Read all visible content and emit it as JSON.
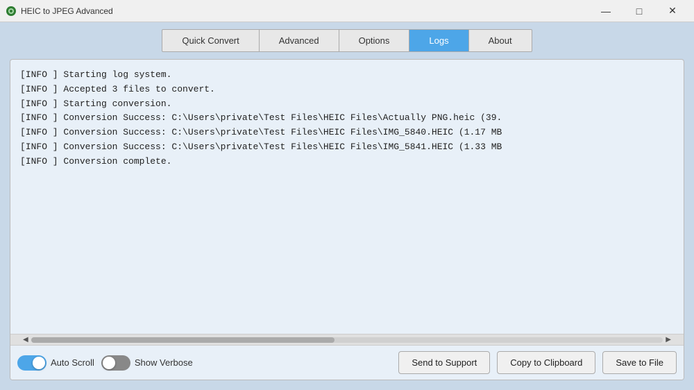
{
  "titlebar": {
    "title": "HEIC to JPEG Advanced",
    "minimize": "—",
    "maximize": "□",
    "close": "✕"
  },
  "tabs": [
    {
      "id": "quick-convert",
      "label": "Quick Convert",
      "active": false
    },
    {
      "id": "advanced",
      "label": "Advanced",
      "active": false
    },
    {
      "id": "options",
      "label": "Options",
      "active": false
    },
    {
      "id": "logs",
      "label": "Logs",
      "active": true
    },
    {
      "id": "about",
      "label": "About",
      "active": false
    }
  ],
  "log_lines": [
    "[INFO   ] Starting log system.",
    "[INFO   ] Accepted 3 files to convert.",
    "[INFO   ] Starting conversion.",
    "[INFO   ] Conversion Success: C:\\Users\\private\\Test Files\\HEIC Files\\Actually PNG.heic (39.",
    "[INFO   ] Conversion Success: C:\\Users\\private\\Test Files\\HEIC Files\\IMG_5840.HEIC (1.17 MB",
    "[INFO   ] Conversion Success: C:\\Users\\private\\Test Files\\HEIC Files\\IMG_5841.HEIC (1.33 MB",
    "[INFO   ] Conversion complete."
  ],
  "controls": {
    "auto_scroll_label": "Auto Scroll",
    "auto_scroll_on": true,
    "show_verbose_label": "Show Verbose",
    "show_verbose_on": false
  },
  "buttons": {
    "send_to_support": "Send to Support",
    "copy_to_clipboard": "Copy to Clipboard",
    "save_to_file": "Save to File"
  }
}
